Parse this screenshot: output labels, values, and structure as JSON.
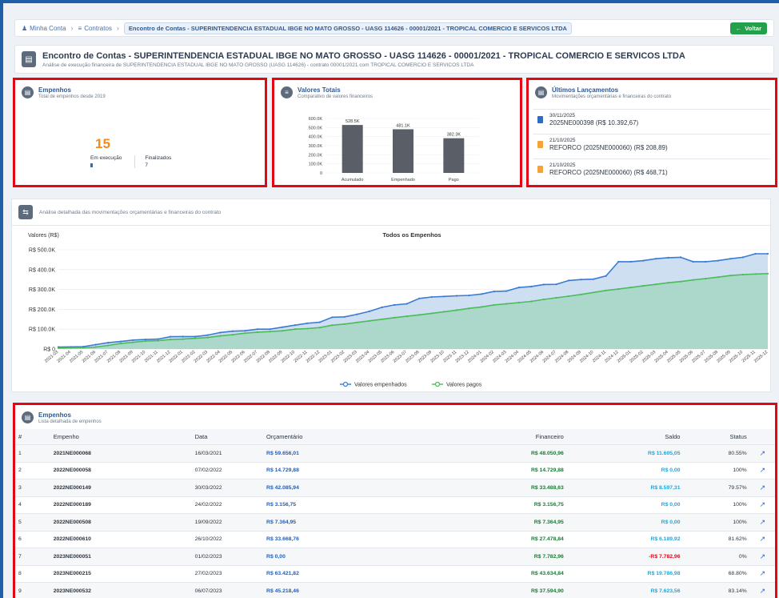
{
  "breadcrumb": {
    "home": "Minha Conta",
    "contracts": "Contratos",
    "current": "Encontro de Contas - SUPERINTENDENCIA ESTADUAL IBGE NO MATO GROSSO - UASG 114626 - 00001/2021 - TROPICAL COMERCIO E SERVICOS LTDA",
    "back_label": "Voltar"
  },
  "header": {
    "title": "Encontro de Contas - SUPERINTENDENCIA ESTADUAL IBGE NO MATO GROSSO - UASG 114626 - 00001/2021 - TROPICAL COMERCIO E SERVICOS LTDA",
    "subtitle": "Análise de execução financeira de SUPERINTENDENCIA ESTADUAL IBGE NO MATO GROSSO (UASG 114626) - contrato 00001/2021 com TROPICAL COMERCIO E SERVICOS LTDA"
  },
  "empenhos_card": {
    "title": "Empenhos",
    "subtitle": "Total de empenhos desde 2019",
    "total": "15",
    "em_execucao_label": "Em execução",
    "em_execucao_value": "",
    "finalizados_label": "Finalizados",
    "finalizados_value": "7"
  },
  "valores_card": {
    "title": "Valores Totais",
    "subtitle": "Comparativo de valores financeiros"
  },
  "ultimos_card": {
    "title": "Últimos Lançamentos",
    "subtitle": "Movimentações orçamentárias e financeiras do contrato",
    "items": [
      {
        "date": "30/11/2025",
        "desc": "2025NE000398 (R$ 10.392,67)",
        "color": "#2d6cc0"
      },
      {
        "date": "21/10/2025",
        "desc": "REFORCO (2025NE000060) (R$ 208,89)",
        "color": "#f2a33a"
      },
      {
        "date": "21/10/2025",
        "desc": "REFORCO (2025NE000060) (R$ 468,71)",
        "color": "#f2a33a"
      }
    ]
  },
  "analysis": {
    "text": "Análise detalhada das movimentações orçamentárias e financeiras do contrato"
  },
  "tabela": {
    "title": "Empenhos",
    "subtitle": "Lista detalhada de empenhos",
    "headers": [
      "#",
      "Empenho",
      "Data",
      "Orçamentário",
      "Financeiro",
      "Saldo",
      "Status"
    ],
    "rows": [
      [
        "1",
        "2021NE000068",
        "16/03/2021",
        "R$ 59.656,01",
        "R$ 48.050,96",
        "R$ 11.605,05",
        "80.55%"
      ],
      [
        "2",
        "2022NE000058",
        "07/02/2022",
        "R$ 14.729,88",
        "R$ 14.729,88",
        "R$ 0,00",
        "100%"
      ],
      [
        "3",
        "2022NE000149",
        "30/03/2022",
        "R$ 42.085,94",
        "R$ 33.488,63",
        "R$ 8.597,31",
        "79.57%"
      ],
      [
        "4",
        "2022NE000189",
        "24/02/2022",
        "R$ 3.156,75",
        "R$ 3.156,75",
        "R$ 0,00",
        "100%"
      ],
      [
        "5",
        "2022NE000508",
        "19/09/2022",
        "R$ 7.364,95",
        "R$ 7.364,95",
        "R$ 0,00",
        "100%"
      ],
      [
        "6",
        "2022NE000610",
        "26/10/2022",
        "R$ 33.668,76",
        "R$ 27.478,84",
        "R$ 6.189,92",
        "81.62%"
      ],
      [
        "7",
        "2023NE000051",
        "01/02/2023",
        "R$ 0,00",
        "R$ 7.782,96",
        "-R$ 7.782,96",
        "0%"
      ],
      [
        "8",
        "2023NE000215",
        "27/02/2023",
        "R$ 63.421,82",
        "R$ 43.634,84",
        "R$ 19.786,98",
        "68.80%"
      ],
      [
        "9",
        "2023NE000532",
        "06/07/2023",
        "R$ 45.218,46",
        "R$ 37.594,90",
        "R$ 7.623,56",
        "83.14%"
      ]
    ]
  },
  "chart_data": [
    {
      "type": "bar",
      "categories": [
        "Acumulado",
        "Empenhado",
        "Pago"
      ],
      "values": [
        528.5,
        481.1,
        382.3
      ],
      "data_labels": [
        "528.5K",
        "481.1K",
        "382.3K"
      ],
      "ytick_labels": [
        "0",
        "100.0K",
        "200.0K",
        "300.0K",
        "400.0K",
        "500.0K",
        "600.0K"
      ],
      "ylim": [
        0,
        600
      ],
      "color": "#5a5e66"
    },
    {
      "type": "area",
      "title": "Todos os Empenhos",
      "ylabel": "Valores (R$)",
      "ylim": [
        0,
        500
      ],
      "ytick_labels": [
        "R$ 0",
        "R$ 100.0K",
        "R$ 200.0K",
        "R$ 300.0K",
        "R$ 400.0K",
        "R$ 500.0K"
      ],
      "x": [
        "2021-03",
        "2021-04",
        "2021-05",
        "2021-06",
        "2021-07",
        "2021-08",
        "2021-09",
        "2021-10",
        "2021-11",
        "2021-12",
        "2022-01",
        "2022-02",
        "2022-03",
        "2022-04",
        "2022-05",
        "2022-06",
        "2022-07",
        "2022-08",
        "2022-09",
        "2022-10",
        "2022-11",
        "2022-12",
        "2023-01",
        "2023-02",
        "2023-03",
        "2023-04",
        "2023-05",
        "2023-06",
        "2023-07",
        "2023-08",
        "2023-09",
        "2023-10",
        "2023-11",
        "2023-12",
        "2024-01",
        "2024-02",
        "2024-03",
        "2024-04",
        "2024-05",
        "2024-06",
        "2024-07",
        "2024-08",
        "2024-09",
        "2024-10",
        "2024-11",
        "2024-12",
        "2025-01",
        "2025-02",
        "2025-03",
        "2025-04",
        "2025-05",
        "2025-06",
        "2025-07",
        "2025-08",
        "2025-09",
        "2025-10",
        "2025-11",
        "2025-12"
      ],
      "series": [
        {
          "name": "Valores empenhados",
          "color": "#3a7bd5",
          "fill": "#c6d9f0",
          "values": [
            10,
            11,
            12,
            22,
            32,
            38,
            45,
            48,
            50,
            62,
            63,
            63,
            70,
            83,
            90,
            92,
            100,
            100,
            110,
            120,
            130,
            135,
            160,
            162,
            175,
            190,
            210,
            222,
            228,
            255,
            262,
            265,
            268,
            270,
            277,
            290,
            292,
            310,
            315,
            325,
            326,
            345,
            350,
            352,
            368,
            440,
            440,
            445,
            455,
            460,
            462,
            440,
            440,
            445,
            455,
            462,
            480,
            480
          ]
        },
        {
          "name": "Valores pagos",
          "color": "#4cbb5a",
          "fill": "#a6d7c4",
          "values": [
            5,
            6,
            7,
            10,
            18,
            28,
            34,
            40,
            42,
            48,
            50,
            54,
            58,
            66,
            72,
            80,
            85,
            88,
            92,
            100,
            103,
            108,
            120,
            126,
            134,
            142,
            150,
            158,
            165,
            172,
            180,
            188,
            196,
            205,
            212,
            222,
            228,
            234,
            240,
            250,
            258,
            266,
            275,
            285,
            295,
            302,
            310,
            318,
            326,
            334,
            340,
            348,
            355,
            362,
            370,
            375,
            378,
            380
          ]
        }
      ]
    }
  ]
}
